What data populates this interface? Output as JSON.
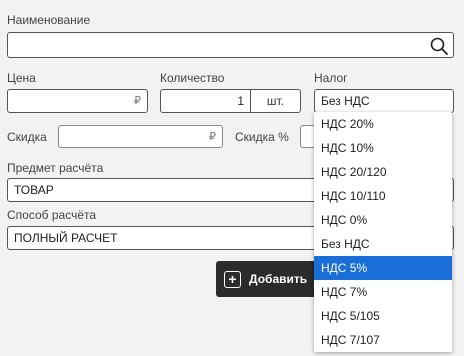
{
  "form": {
    "name_label": "Наименование",
    "name_value": "",
    "price_label": "Цена",
    "price_value": "",
    "currency_symbol": "₽",
    "quantity_label": "Количество",
    "quantity_value": "1",
    "quantity_unit": "шт.",
    "tax_label": "Налог",
    "tax_value": "Без НДС",
    "discount_label": "Скидка",
    "discount_value": "",
    "discount_percent_label": "Скидка %",
    "subject_label": "Предмет расчёта",
    "subject_value": "ТОВАР",
    "method_label": "Способ расчёта",
    "method_value": "ПОЛНЫЙ РАСЧЕТ",
    "add_button_label": "Добавить"
  },
  "tax_dropdown": {
    "options": [
      "НДС 20%",
      "НДС 10%",
      "НДС 20/120",
      "НДС 10/110",
      "НДС 0%",
      "Без НДС",
      "НДС 5%",
      "НДС 7%",
      "НДС 5/105",
      "НДС 7/107"
    ],
    "highlighted": "НДС 5%"
  },
  "colors": {
    "highlight": "#1a6ed8",
    "button_bg": "#2b2b2b",
    "page_bg": "#f2f2f2"
  },
  "icons": {
    "search": "search-icon",
    "add": "plus-square-icon"
  }
}
